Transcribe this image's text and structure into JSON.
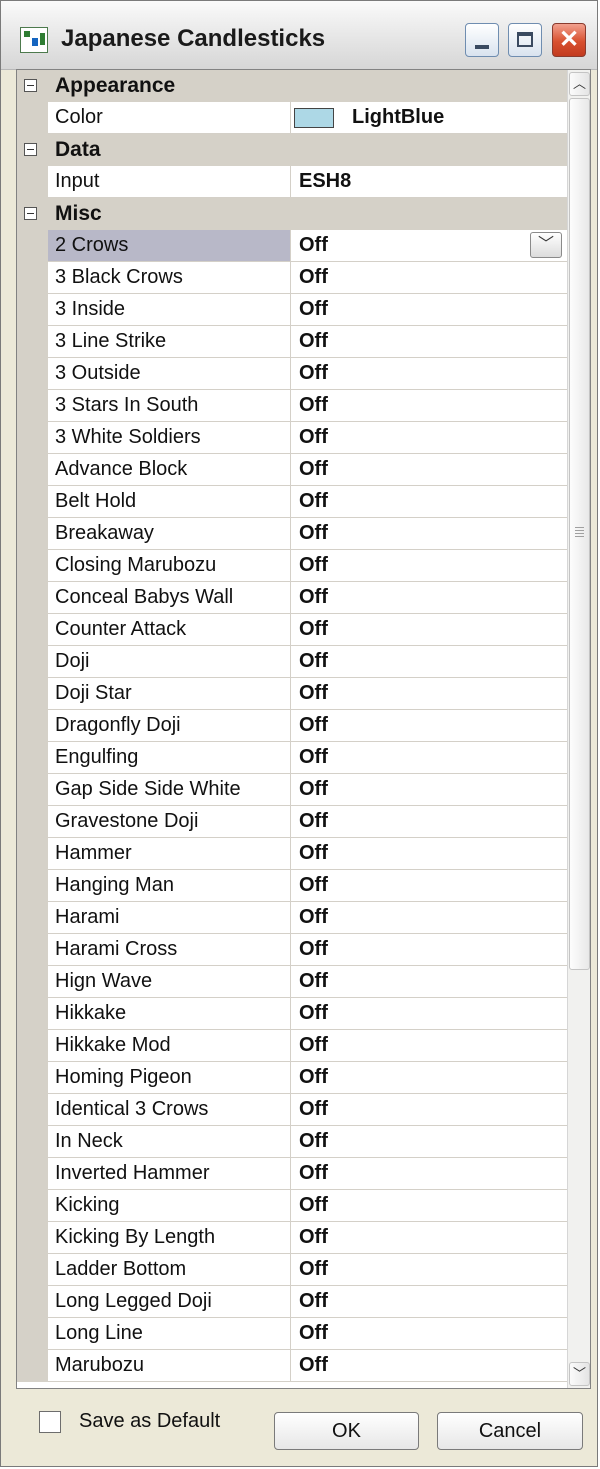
{
  "window": {
    "title": "Japanese Candlesticks",
    "close_glyph": "✕",
    "app_icon": "candlestick-app-icon"
  },
  "grid": {
    "categories": [
      {
        "label": "Appearance",
        "properties": [
          {
            "name": "Color",
            "value": "LightBlue",
            "swatch_color": "#add8e6"
          }
        ]
      },
      {
        "label": "Data",
        "properties": [
          {
            "name": "Input",
            "value": "ESH8"
          }
        ]
      },
      {
        "label": "Misc",
        "selected_index": 0,
        "properties": [
          {
            "name": "2 Crows",
            "value": "Off"
          },
          {
            "name": "3 Black Crows",
            "value": "Off"
          },
          {
            "name": "3 Inside",
            "value": "Off"
          },
          {
            "name": "3 Line Strike",
            "value": "Off"
          },
          {
            "name": "3 Outside",
            "value": "Off"
          },
          {
            "name": "3 Stars In South",
            "value": "Off"
          },
          {
            "name": "3 White Soldiers",
            "value": "Off"
          },
          {
            "name": "Advance Block",
            "value": "Off"
          },
          {
            "name": "Belt Hold",
            "value": "Off"
          },
          {
            "name": "Breakaway",
            "value": "Off"
          },
          {
            "name": "Closing Marubozu",
            "value": "Off"
          },
          {
            "name": "Conceal Babys Wall",
            "value": "Off"
          },
          {
            "name": "Counter Attack",
            "value": "Off"
          },
          {
            "name": "Doji",
            "value": "Off"
          },
          {
            "name": "Doji Star",
            "value": "Off"
          },
          {
            "name": "Dragonfly Doji",
            "value": "Off"
          },
          {
            "name": "Engulfing",
            "value": "Off"
          },
          {
            "name": "Gap Side Side White",
            "value": "Off"
          },
          {
            "name": "Gravestone Doji",
            "value": "Off"
          },
          {
            "name": "Hammer",
            "value": "Off"
          },
          {
            "name": "Hanging Man",
            "value": "Off"
          },
          {
            "name": "Harami",
            "value": "Off"
          },
          {
            "name": "Harami Cross",
            "value": "Off"
          },
          {
            "name": "Hign Wave",
            "value": "Off"
          },
          {
            "name": "Hikkake",
            "value": "Off"
          },
          {
            "name": "Hikkake Mod",
            "value": "Off"
          },
          {
            "name": "Homing Pigeon",
            "value": "Off"
          },
          {
            "name": "Identical 3 Crows",
            "value": "Off"
          },
          {
            "name": "In Neck",
            "value": "Off"
          },
          {
            "name": "Inverted Hammer",
            "value": "Off"
          },
          {
            "name": "Kicking",
            "value": "Off"
          },
          {
            "name": "Kicking By Length",
            "value": "Off"
          },
          {
            "name": "Ladder Bottom",
            "value": "Off"
          },
          {
            "name": "Long Legged Doji",
            "value": "Off"
          },
          {
            "name": "Long Line",
            "value": "Off"
          },
          {
            "name": "Marubozu",
            "value": "Off"
          }
        ]
      }
    ]
  },
  "footer": {
    "save_default_label": "Save as Default",
    "save_default_checked": false,
    "ok_label": "OK",
    "cancel_label": "Cancel"
  }
}
